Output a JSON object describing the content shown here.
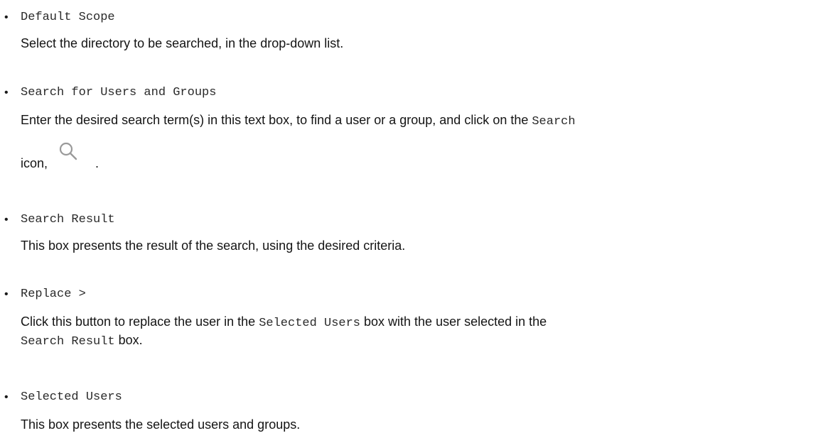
{
  "items": [
    {
      "term": "Default Scope",
      "description": "Select the directory to be searched, in the drop-down list."
    },
    {
      "term": "Search for Users and Groups",
      "description_part1": "Enter the desired search term(s) in this text box, to find a user or a group, and click on the ",
      "description_code": "Search",
      "description_part2": "icon,",
      "description_part3": ".",
      "icon": "search-icon"
    },
    {
      "term": "Search Result",
      "description": "This box presents the result of the search, using the desired criteria."
    },
    {
      "term": "Replace >",
      "description_part1": "Click this button to replace the user in the ",
      "description_code1": "Selected Users",
      "description_part2": " box with the user selected in the",
      "description_code2": "Search Result",
      "description_part3": " box."
    },
    {
      "term": "Selected Users",
      "description": "This box presents the selected users and groups."
    }
  ],
  "bullet": "•"
}
